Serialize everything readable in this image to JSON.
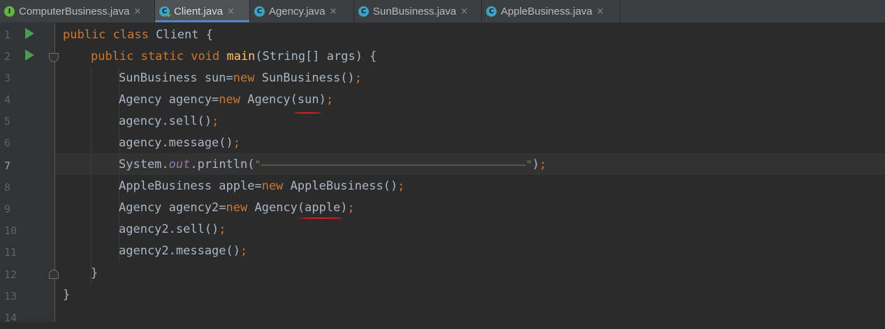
{
  "tabs": [
    {
      "label": "ComputerBusiness.java",
      "icon": "interface-file-icon",
      "close": "×"
    },
    {
      "label": "Client.java",
      "icon": "class-main-file-icon",
      "close": "×"
    },
    {
      "label": "Agency.java",
      "icon": "class-file-icon",
      "close": "×"
    },
    {
      "label": "SunBusiness.java",
      "icon": "class-file-icon",
      "close": "×"
    },
    {
      "label": "AppleBusiness.java",
      "icon": "class-file-icon",
      "close": "×"
    }
  ],
  "line_numbers": [
    "1",
    "2",
    "3",
    "4",
    "5",
    "6",
    "7",
    "8",
    "9",
    "10",
    "11",
    "12",
    "13",
    "14"
  ],
  "code": {
    "l1": {
      "kw": "public class ",
      "rest": "Client {"
    },
    "l2": {
      "kw": "public static void ",
      "fn": "main",
      "rest": "(String[] args) {"
    },
    "l3": {
      "a": "SunBusiness sun=",
      "kw": "new ",
      "b": "SunBusiness()",
      "p": ";"
    },
    "l4": {
      "a": "Agency agency=",
      "kw": "new ",
      "b": "Agency(sun)",
      "p": ";"
    },
    "l5": {
      "a": "agency.sell()",
      "p": ";"
    },
    "l6": {
      "a": "agency.message()",
      "p": ";"
    },
    "l7": {
      "a": "System.",
      "fld": "out",
      "b": ".println(",
      "str": "\"——————————————————————————————————————————\"",
      "c": ")",
      "p": ";"
    },
    "l8": {
      "a": "AppleBusiness apple=",
      "kw": "new ",
      "b": "AppleBusiness()",
      "p": ";"
    },
    "l9": {
      "a": "Agency agency2=",
      "kw": "new ",
      "b": "Agency(apple)",
      "p": ";"
    },
    "l10": {
      "a": "agency2.sell()",
      "p": ";"
    },
    "l11": {
      "a": "agency2.message()",
      "p": ";"
    },
    "l12": {
      "a": "}"
    },
    "l13": {
      "a": "}"
    }
  },
  "colors": {
    "background": "#2b2b2b",
    "keyword": "#cc7832",
    "function": "#ffc66d",
    "string": "#6a8759",
    "static_field": "#9876aa",
    "annotation_underline": "#e02020"
  }
}
